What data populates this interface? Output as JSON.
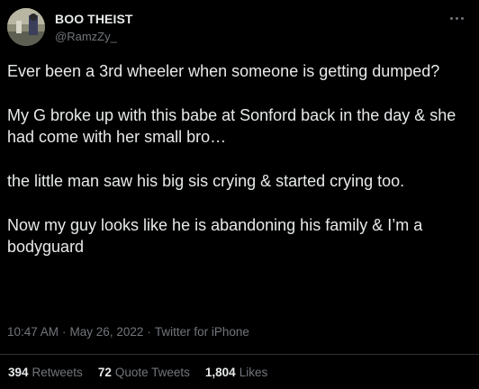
{
  "author": {
    "display_name": "BOO THEIST",
    "handle": "@RamzZy_"
  },
  "more_icon": "more-horizontal-icon",
  "tweet": {
    "paragraphs": [
      "Ever been a 3rd wheeler when someone is getting dumped?",
      "My G broke up with this babe at Sonford back in the day & she had come with her small bro…",
      "the little man saw his big sis crying & started crying too.",
      "Now my guy looks like he is abandoning his family & I’m a bodyguard"
    ]
  },
  "meta": {
    "time": "10:47 AM",
    "separator": "·",
    "date": "May 26, 2022",
    "source": "Twitter for iPhone"
  },
  "stats": {
    "retweets_count": "394",
    "retweets_label": "Retweets",
    "quotes_count": "72",
    "quotes_label": "Quote Tweets",
    "likes_count": "1,804",
    "likes_label": "Likes"
  },
  "colors": {
    "background": "#000000",
    "primary_text": "#e7e9ea",
    "secondary_text": "#71767b",
    "divider": "#2f3336"
  }
}
